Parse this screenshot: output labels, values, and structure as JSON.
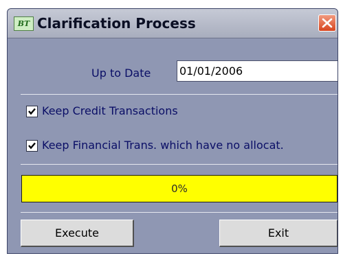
{
  "window": {
    "title": "Clarification Process",
    "icon_text": "BT"
  },
  "form": {
    "date_label": "Up to Date",
    "date_value": "01/01/2006",
    "options": [
      {
        "label": "Keep Credit Transactions",
        "checked": true
      },
      {
        "label": "Keep Financial Trans. which have no allocat.",
        "checked": true
      }
    ]
  },
  "progress": {
    "label": "0%",
    "value": 0
  },
  "buttons": {
    "execute": "Execute",
    "exit": "Exit"
  },
  "colors": {
    "panel": "#8f97b3",
    "progress_bg": "#ffff00",
    "label_text": "#0a0e66"
  }
}
